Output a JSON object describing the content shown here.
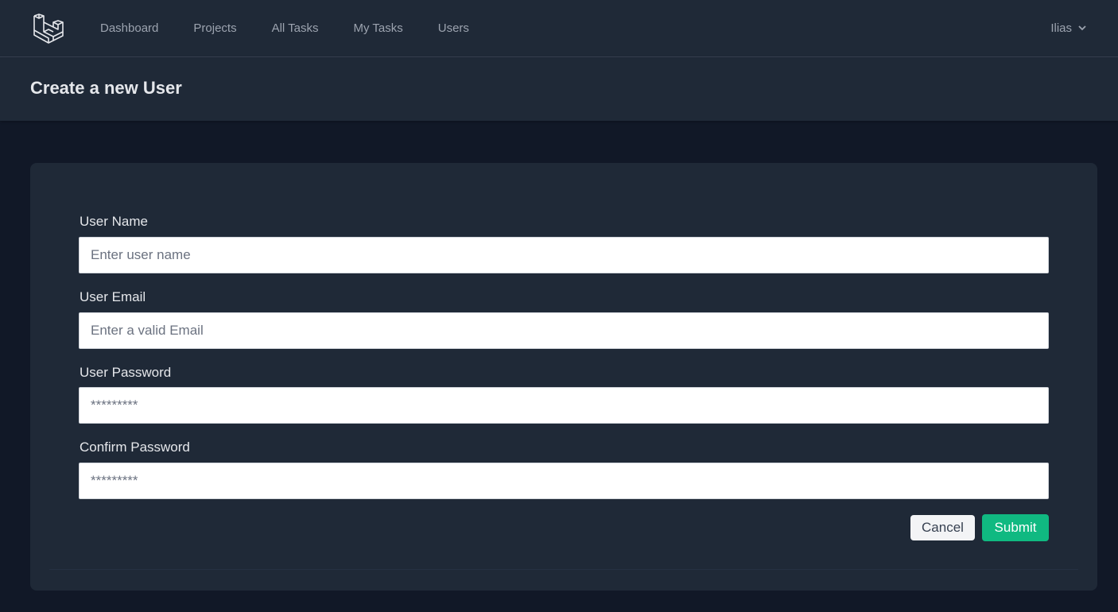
{
  "nav": {
    "links": [
      "Dashboard",
      "Projects",
      "All Tasks",
      "My Tasks",
      "Users"
    ],
    "user": "Ilias"
  },
  "header": {
    "title": "Create a new User"
  },
  "form": {
    "name_label": "User Name",
    "name_placeholder": "Enter user name",
    "email_label": "User Email",
    "email_placeholder": "Enter a valid Email",
    "password_label": "User Password",
    "password_placeholder": "*********",
    "confirm_label": "Confirm Password",
    "confirm_placeholder": "*********",
    "cancel_label": "Cancel",
    "submit_label": "Submit"
  },
  "colors": {
    "background": "#111827",
    "surface": "#1f2937",
    "accent": "#10b981"
  }
}
